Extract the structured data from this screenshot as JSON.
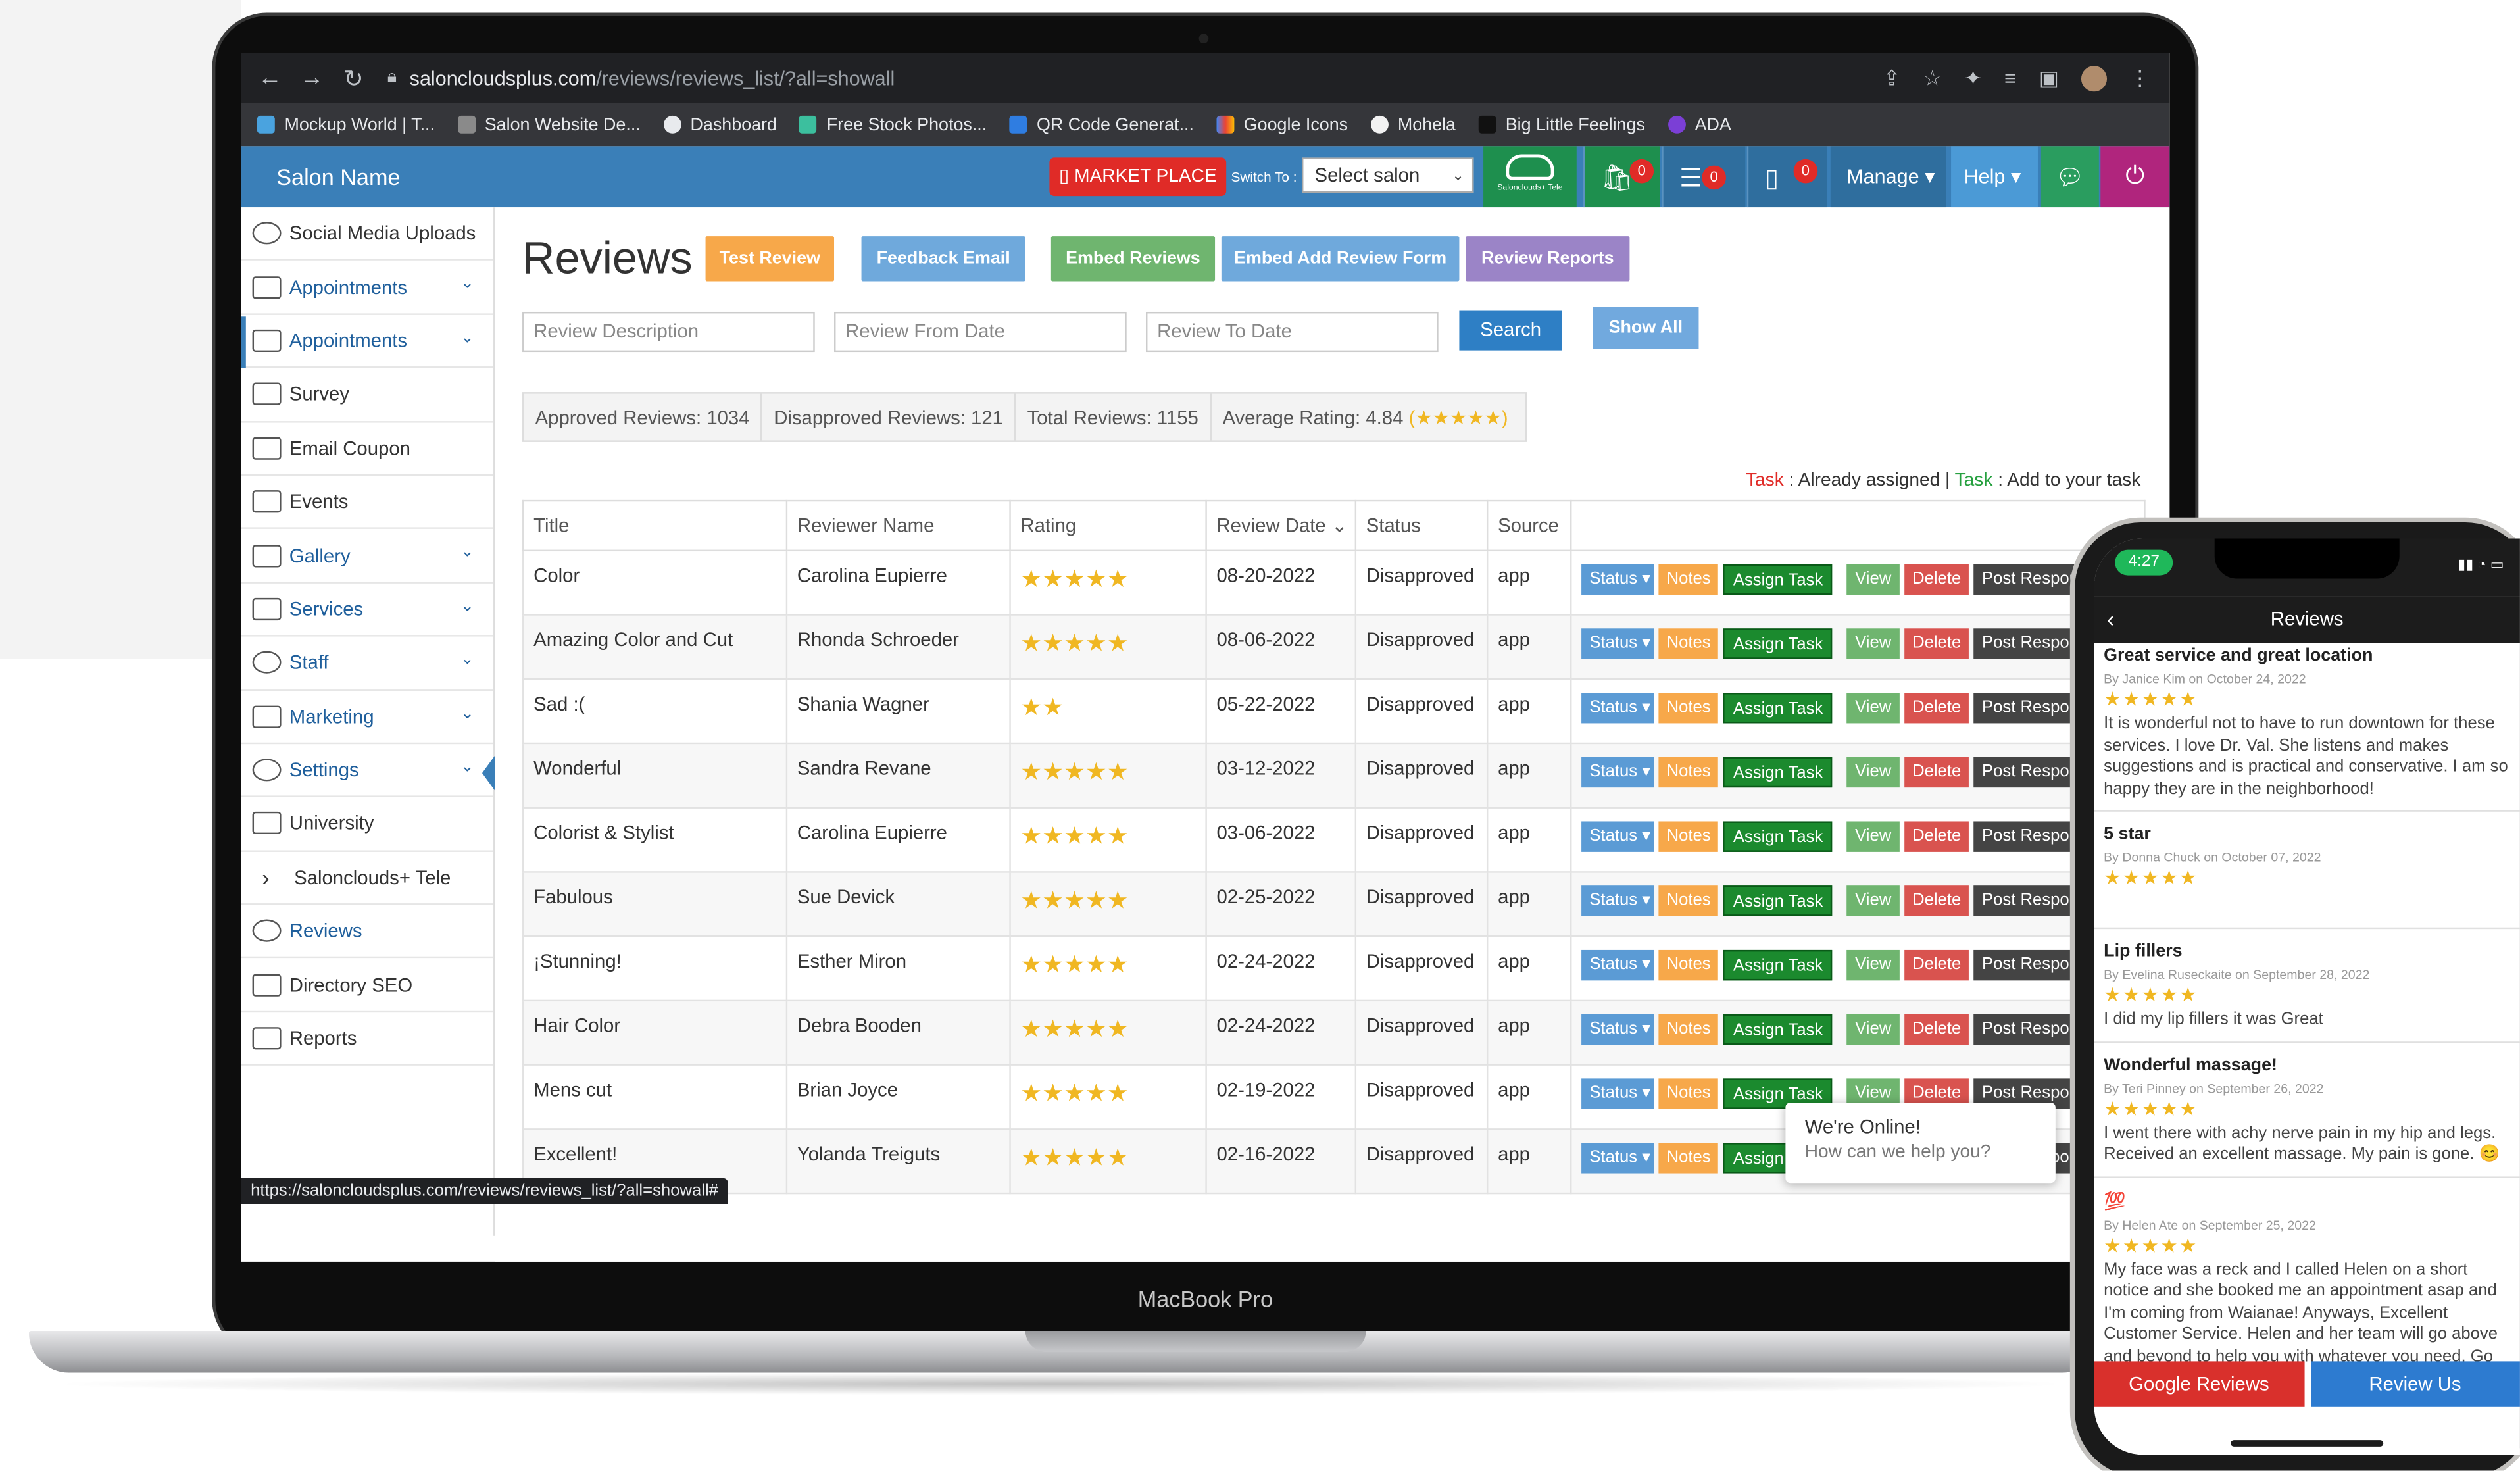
{
  "browser": {
    "url_domain": "saloncloudsplus.com",
    "url_path": "/reviews/reviews_list/?all=showall",
    "bookmarks": [
      "Mockup World | T...",
      "Salon Website De...",
      "Dashboard",
      "Free Stock Photos...",
      "QR Code Generat...",
      "Google Icons",
      "Mohela",
      "Big Little Feelings",
      "ADA"
    ],
    "status_url": "https://saloncloudsplus.com/reviews/reviews_list/?all=showall#"
  },
  "header": {
    "salon_name": "Salon Name",
    "market_place": "MARKET PLACE",
    "switch_to": "Switch To :",
    "select_salon": "Select salon",
    "tele_label": "Salonclouds+ Tele",
    "badge_cart": "0",
    "badge_list": "0",
    "badge_phone": "0",
    "manage": "Manage",
    "help": "Help"
  },
  "sidebar": {
    "items": [
      {
        "label": "Social Media Uploads"
      },
      {
        "label": "Appointments"
      },
      {
        "label": "Appointments"
      },
      {
        "label": "Survey"
      },
      {
        "label": "Email Coupon"
      },
      {
        "label": "Events"
      },
      {
        "label": "Gallery"
      },
      {
        "label": "Services"
      },
      {
        "label": "Staff"
      },
      {
        "label": "Marketing"
      },
      {
        "label": "Settings"
      },
      {
        "label": "University"
      },
      {
        "label": "Salonclouds+ Tele"
      },
      {
        "label": "Reviews"
      },
      {
        "label": "Directory SEO"
      },
      {
        "label": "Reports"
      }
    ]
  },
  "main": {
    "title": "Reviews",
    "buttons": {
      "test_review": "Test Review",
      "feedback_email": "Feedback Email",
      "embed_reviews": "Embed Reviews",
      "embed_add_form": "Embed Add Review Form",
      "review_reports": "Review Reports"
    },
    "filters": {
      "description": "Review Description",
      "from_date": "Review From Date",
      "to_date": "Review To Date",
      "search": "Search",
      "show_all": "Show All"
    },
    "stats": {
      "approved": "Approved Reviews: 1034",
      "disapproved": "Disapproved Reviews: 121",
      "total": "Total Reviews: 1155",
      "average": "Average Rating: 4.84",
      "average_stars": "(★★★★★)"
    },
    "task_note": {
      "task1": "Task",
      "text1": " : Already assigned | ",
      "task2": "Task",
      "text2": " : Add to your task"
    },
    "columns": [
      "Title",
      "Reviewer Name",
      "Rating",
      "Review Date",
      "Status",
      "Source"
    ],
    "actions": {
      "status": "Status",
      "notes": "Notes",
      "assign": "Assign Task",
      "view": "View",
      "delete": "Delete",
      "post": "Post Respon"
    },
    "rows": [
      {
        "title": "Color",
        "reviewer": "Carolina Eupierre",
        "stars": "★★★★★",
        "date": "08-20-2022",
        "status": "Disapproved",
        "source": "app"
      },
      {
        "title": "Amazing Color and Cut",
        "reviewer": "Rhonda Schroeder",
        "stars": "★★★★★",
        "date": "08-06-2022",
        "status": "Disapproved",
        "source": "app"
      },
      {
        "title": "Sad :(",
        "reviewer": "Shania Wagner",
        "stars": "★★",
        "date": "05-22-2022",
        "status": "Disapproved",
        "source": "app"
      },
      {
        "title": "Wonderful",
        "reviewer": "Sandra Revane",
        "stars": "★★★★★",
        "date": "03-12-2022",
        "status": "Disapproved",
        "source": "app"
      },
      {
        "title": "Colorist & Stylist",
        "reviewer": "Carolina Eupierre",
        "stars": "★★★★★",
        "date": "03-06-2022",
        "status": "Disapproved",
        "source": "app"
      },
      {
        "title": "Fabulous",
        "reviewer": "Sue Devick",
        "stars": "★★★★★",
        "date": "02-25-2022",
        "status": "Disapproved",
        "source": "app"
      },
      {
        "title": "¡Stunning!",
        "reviewer": "Esther Miron",
        "stars": "★★★★★",
        "date": "02-24-2022",
        "status": "Disapproved",
        "source": "app"
      },
      {
        "title": "Hair Color",
        "reviewer": "Debra Booden",
        "stars": "★★★★★",
        "date": "02-24-2022",
        "status": "Disapproved",
        "source": "app"
      },
      {
        "title": "Mens cut",
        "reviewer": "Brian Joyce",
        "stars": "★★★★★",
        "date": "02-19-2022",
        "status": "Disapproved",
        "source": "app"
      },
      {
        "title": "Excellent!",
        "reviewer": "Yolanda Treiguts",
        "stars": "★★★★★",
        "date": "02-16-2022",
        "status": "Disapproved",
        "source": "app"
      }
    ]
  },
  "chat_popup": {
    "title": "We're Online!",
    "subtitle": "How can we help you?"
  },
  "laptop_label": "MacBook Pro",
  "phone": {
    "time": "4:27",
    "title": "Reviews",
    "reviews": [
      {
        "title": "Great service and great location",
        "by": "By Janice Kim on October 24, 2022",
        "stars": "★★★★★",
        "text": "It is wonderful not to have to run downtown for these services.  I love Dr. Val. She listens and makes suggestions and is practical and conservative.  I am so happy they are in the neighborhood!"
      },
      {
        "title": "5 star",
        "by": "By Donna Chuck on October 07, 2022",
        "stars": "★★★★★",
        "text": ""
      },
      {
        "title": "Lip fillers",
        "by": "By Evelina Ruseckaite on September 28, 2022",
        "stars": "★★★★★",
        "text": "I did my lip fillers it was Great"
      },
      {
        "title": "Wonderful massage!",
        "by": "By Teri Pinney on September 26, 2022",
        "stars": "★★★★★",
        "text": "I went there with achy nerve pain in my hip and legs. Received an excellent massage. My pain is gone. 😊"
      },
      {
        "title": "💯",
        "by": "By Helen Ate on September 25, 2022",
        "stars": "★★★★★",
        "text": "My face was a reck and I called Helen on a short notice and she booked me an appointment asap and I'm coming from Waianae! Anyways, Excellent Customer Service. Helen and her team will go above and beyond to help you with whatever you need. Go See Them. You won't Regret It!!"
      }
    ],
    "google_reviews": "Google Reviews",
    "review_us": "Review Us"
  },
  "colors": {
    "header_blue": "#3a7fb8",
    "market_red": "#e02b27",
    "test_review": "#f7a84a",
    "feedback_email": "#5b9bd5",
    "embed_reviews": "#6fb56f",
    "embed_add_form": "#5b9bd5",
    "review_reports": "#9b84c7",
    "google_btn": "#d9302c",
    "review_us_btn": "#2d7bd0"
  }
}
